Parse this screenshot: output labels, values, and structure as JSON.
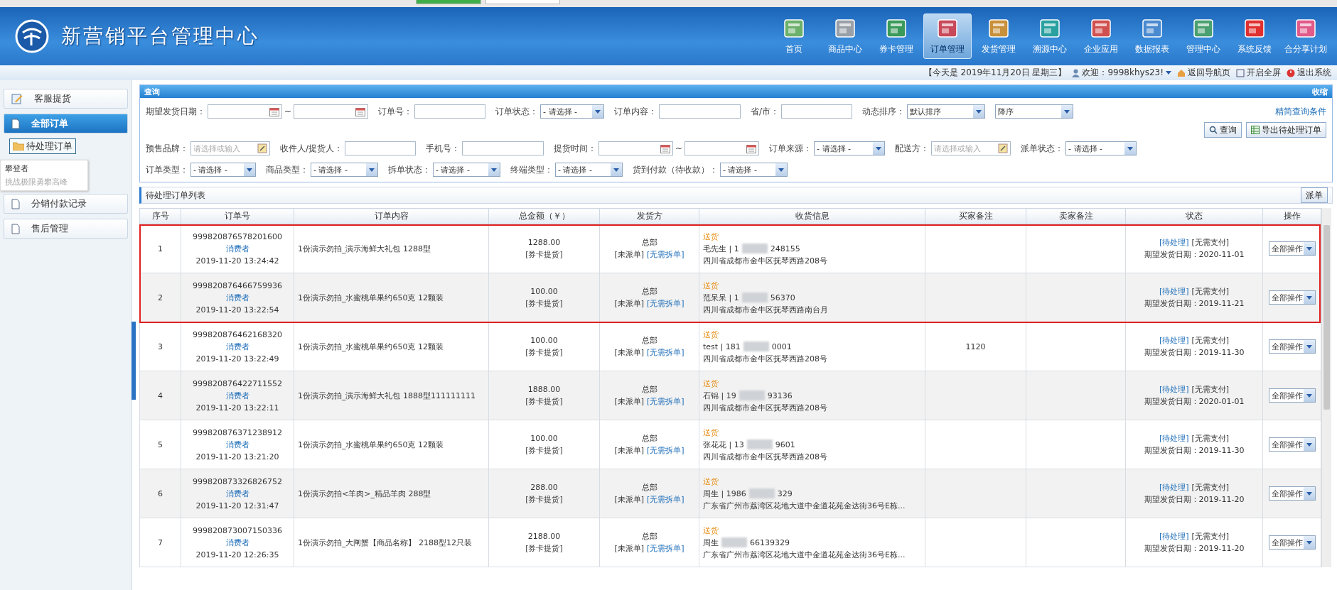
{
  "header": {
    "title": "新营销平台管理中心",
    "nav": [
      {
        "label": "首页",
        "selected": false
      },
      {
        "label": "商品中心",
        "selected": false
      },
      {
        "label": "券卡管理",
        "selected": false
      },
      {
        "label": "订单管理",
        "selected": true
      },
      {
        "label": "发货管理",
        "selected": false
      },
      {
        "label": "溯源中心",
        "selected": false
      },
      {
        "label": "企业应用",
        "selected": false
      },
      {
        "label": "数据报表",
        "selected": false
      },
      {
        "label": "管理中心",
        "selected": false
      },
      {
        "label": "系统反馈",
        "selected": false
      },
      {
        "label": "合分享计划",
        "selected": false
      }
    ]
  },
  "info_bar": {
    "date": "【今天是 2019年11月20日 星期三】",
    "welcome": "欢迎：9998khys23!",
    "links": [
      "返回导航页",
      "开启全屏",
      "退出系统"
    ]
  },
  "sidebar": {
    "items": [
      {
        "label": "客服提货",
        "selected": false
      },
      {
        "label": "全部订单",
        "selected": true,
        "children": [
          {
            "label": "待处理订单",
            "selected": true
          }
        ]
      },
      {
        "label": "分销付款记录",
        "selected": false
      },
      {
        "label": "售后管理",
        "selected": false
      }
    ],
    "tooltip": {
      "title": "攀登者",
      "text": "挑战极限勇攀高峰"
    }
  },
  "query": {
    "title": "查询",
    "collapse": "收缩",
    "simplify_link": "精简查询条件",
    "rows": [
      [
        {
          "kind": "date_range",
          "label": "期望发货日期：",
          "separator": "~"
        },
        {
          "kind": "input",
          "label": "订单号："
        },
        {
          "kind": "select",
          "label": "订单状态：",
          "value": "- 请选择 -"
        },
        {
          "kind": "input",
          "label": "订单内容："
        },
        {
          "kind": "input",
          "label": "省/市："
        },
        {
          "kind": "select",
          "label": "动态排序：",
          "value": "默认排序"
        },
        {
          "kind": "select",
          "value": "降序"
        }
      ],
      [
        {
          "kind": "picker",
          "label": "预售品牌：",
          "placeholder": "请选择或输入"
        },
        {
          "kind": "input",
          "label": "收件人/提货人："
        },
        {
          "kind": "input",
          "label": "手机号："
        },
        {
          "kind": "date_range",
          "label": "提货时间：",
          "separator": "~"
        },
        {
          "kind": "select",
          "label": "订单来源：",
          "value": "- 请选择 -"
        },
        {
          "kind": "picker",
          "label": "配送方：",
          "placeholder": "请选择或输入"
        },
        {
          "kind": "select",
          "label": "派单状态：",
          "value": "- 请选择 -"
        }
      ],
      [
        {
          "kind": "select",
          "label": "订单类型：",
          "value": "- 请选择 -"
        },
        {
          "kind": "select",
          "label": "商品类型：",
          "value": "- 请选择 -"
        },
        {
          "kind": "select",
          "label": "拆单状态：",
          "value": "- 请选择 -"
        },
        {
          "kind": "select",
          "label": "终端类型：",
          "value": "- 请选择 -"
        },
        {
          "kind": "select",
          "label": "货到付款（待收款）：",
          "value": "- 请选择 -"
        }
      ]
    ],
    "buttons": [
      "查询",
      "导出待处理订单"
    ]
  },
  "list": {
    "title": "待处理订单列表",
    "dispatch_button": "派单",
    "columns": [
      "序号",
      "订单号",
      "订单内容",
      "总金额（￥）",
      "发货方",
      "收货信息",
      "买家备注",
      "卖家备注",
      "状态",
      "操作"
    ],
    "rows": [
      {
        "seq": "1",
        "order_no": "999820876578201600",
        "buyer": "消费者",
        "time": "2019-11-20 13:24:42",
        "content": "1份演示勿拍_演示海鲜大礼包 1288型",
        "amount": "1288.00",
        "pay_type": "[券卡提货]",
        "shipper": "总部",
        "dispatch": "[未派单]",
        "split": "[无需拆单]",
        "delivery": "送货",
        "contact": "毛先生 | 1",
        "phone_tail": "248155",
        "address": "四川省成都市金牛区抚琴西路208号",
        "status": "[待处理]",
        "payment": "[无需支付]",
        "expected": "期望发货日期：2020-11-01",
        "action": "全部操作",
        "highlighted": true
      },
      {
        "seq": "2",
        "order_no": "999820876466759936",
        "buyer": "消费者",
        "time": "2019-11-20 13:22:54",
        "content": "1份演示勿拍_水蜜桃单果约650克 12颗装",
        "amount": "100.00",
        "pay_type": "[券卡提货]",
        "shipper": "总部",
        "dispatch": "[未派单]",
        "split": "[无需拆单]",
        "delivery": "送货",
        "contact": "范呆呆 | 1",
        "phone_tail": "56370",
        "address": "四川省成都市金牛区抚琴西路南台月",
        "status": "[待处理]",
        "payment": "[无需支付]",
        "expected": "期望发货日期：2019-11-21",
        "action": "全部操作",
        "highlighted": true
      },
      {
        "seq": "3",
        "order_no": "999820876462168320",
        "buyer": "消费者",
        "time": "2019-11-20 13:22:49",
        "content": "1份演示勿拍_水蜜桃单果约650克 12颗装",
        "amount": "100.00",
        "pay_type": "[券卡提货]",
        "shipper": "总部",
        "dispatch": "[未派单]",
        "split": "[无需拆单]",
        "delivery": "送货",
        "contact": "test | 181",
        "phone_tail": "0001",
        "address": "四川省成都市金牛区抚琴西路208号",
        "buyer_note": "1120",
        "status": "[待处理]",
        "payment": "[无需支付]",
        "expected": "期望发货日期：2019-11-30",
        "action": "全部操作",
        "highlighted": false
      },
      {
        "seq": "4",
        "order_no": "999820876422711552",
        "buyer": "消费者",
        "time": "2019-11-20 13:22:11",
        "content": "1份演示勿拍_演示海鲜大礼包 1888型111111111",
        "amount": "1888.00",
        "pay_type": "[券卡提货]",
        "shipper": "总部",
        "dispatch": "[未派单]",
        "split": "[无需拆单]",
        "delivery": "送货",
        "contact": "石锦 | 19",
        "phone_tail": "93136",
        "address": "四川省成都市金牛区抚琴西路208号",
        "status": "[待处理]",
        "payment": "[无需支付]",
        "expected": "期望发货日期：2020-01-01",
        "action": "全部操作",
        "highlighted": false
      },
      {
        "seq": "5",
        "order_no": "999820876371238912",
        "buyer": "消费者",
        "time": "2019-11-20 13:21:20",
        "content": "1份演示勿拍_水蜜桃单果约650克 12颗装",
        "amount": "100.00",
        "pay_type": "[券卡提货]",
        "shipper": "总部",
        "dispatch": "[未派单]",
        "split": "[无需拆单]",
        "delivery": "送货",
        "contact": "张花花 | 13",
        "phone_tail": "9601",
        "address": "四川省成都市金牛区抚琴西路208号",
        "status": "[待处理]",
        "payment": "[无需支付]",
        "expected": "期望发货日期：2019-11-30",
        "action": "全部操作",
        "highlighted": false
      },
      {
        "seq": "6",
        "order_no": "999820873326826752",
        "buyer": "消费者",
        "time": "2019-11-20 12:31:47",
        "content": "1份演示勿拍<羊肉>_精品羊肉 288型",
        "amount": "288.00",
        "pay_type": "[券卡提货]",
        "shipper": "总部",
        "dispatch": "[未派单]",
        "split": "[无需拆单]",
        "delivery": "送货",
        "contact": "周生 | 1986",
        "phone_tail": "329",
        "address": "广东省广州市荔湾区花地大道中金道花苑金达街36号E栋...",
        "status": "[待处理]",
        "payment": "[无需支付]",
        "expected": "期望发货日期：2019-11-20",
        "action": "全部操作",
        "highlighted": false
      },
      {
        "seq": "7",
        "order_no": "999820873007150336",
        "buyer": "消费者",
        "time": "2019-11-20 12:26:35",
        "content": "1份演示勿拍_大闸蟹【商品名称】 2188型12只装",
        "amount": "2188.00",
        "pay_type": "[券卡提货]",
        "shipper": "总部",
        "dispatch": "[未派单]",
        "split": "[无需拆单]",
        "delivery": "送货",
        "contact": "周生",
        "phone_tail": "66139329",
        "address": "广东省广州市荔湾区花地大道中金道花苑金达街36号E栋...",
        "status": "[待处理]",
        "payment": "[无需支付]",
        "expected": "期望发货日期：2019-11-20",
        "action": "全部操作",
        "highlighted": false
      }
    ]
  }
}
